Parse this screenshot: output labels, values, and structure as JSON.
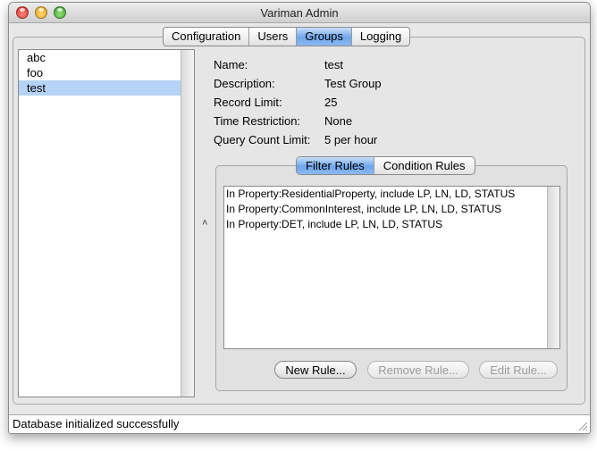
{
  "window": {
    "title": "Variman Admin"
  },
  "main_tabs": [
    {
      "label": "Configuration"
    },
    {
      "label": "Users"
    },
    {
      "label": "Groups"
    },
    {
      "label": "Logging"
    }
  ],
  "groups": [
    {
      "label": "abc"
    },
    {
      "label": "foo"
    },
    {
      "label": "test"
    }
  ],
  "details": {
    "name_label": "Name:",
    "name_value": "test",
    "description_label": "Description:",
    "description_value": "Test Group",
    "record_limit_label": "Record Limit:",
    "record_limit_value": "25",
    "time_restriction_label": "Time Restriction:",
    "time_restriction_value": "None",
    "query_count_label": "Query Count Limit:",
    "query_count_value": "5 per hour"
  },
  "rule_tabs": [
    {
      "label": "Filter Rules"
    },
    {
      "label": "Condition Rules"
    }
  ],
  "rules": [
    {
      "text": "In Property:ResidentialProperty, include LP, LN, LD, STATUS"
    },
    {
      "text": "In Property:CommonInterest, include LP, LN, LD, STATUS"
    },
    {
      "text": "In Property:DET, include LP, LN, LD, STATUS"
    }
  ],
  "buttons": {
    "new_rule": "New Rule...",
    "remove_rule": "Remove Rule...",
    "edit_rule": "Edit Rule..."
  },
  "status": {
    "text": "Database initialized successfully"
  },
  "colors": {
    "selection": "#b5d3f6",
    "active_tab": "#6fa6ec"
  }
}
